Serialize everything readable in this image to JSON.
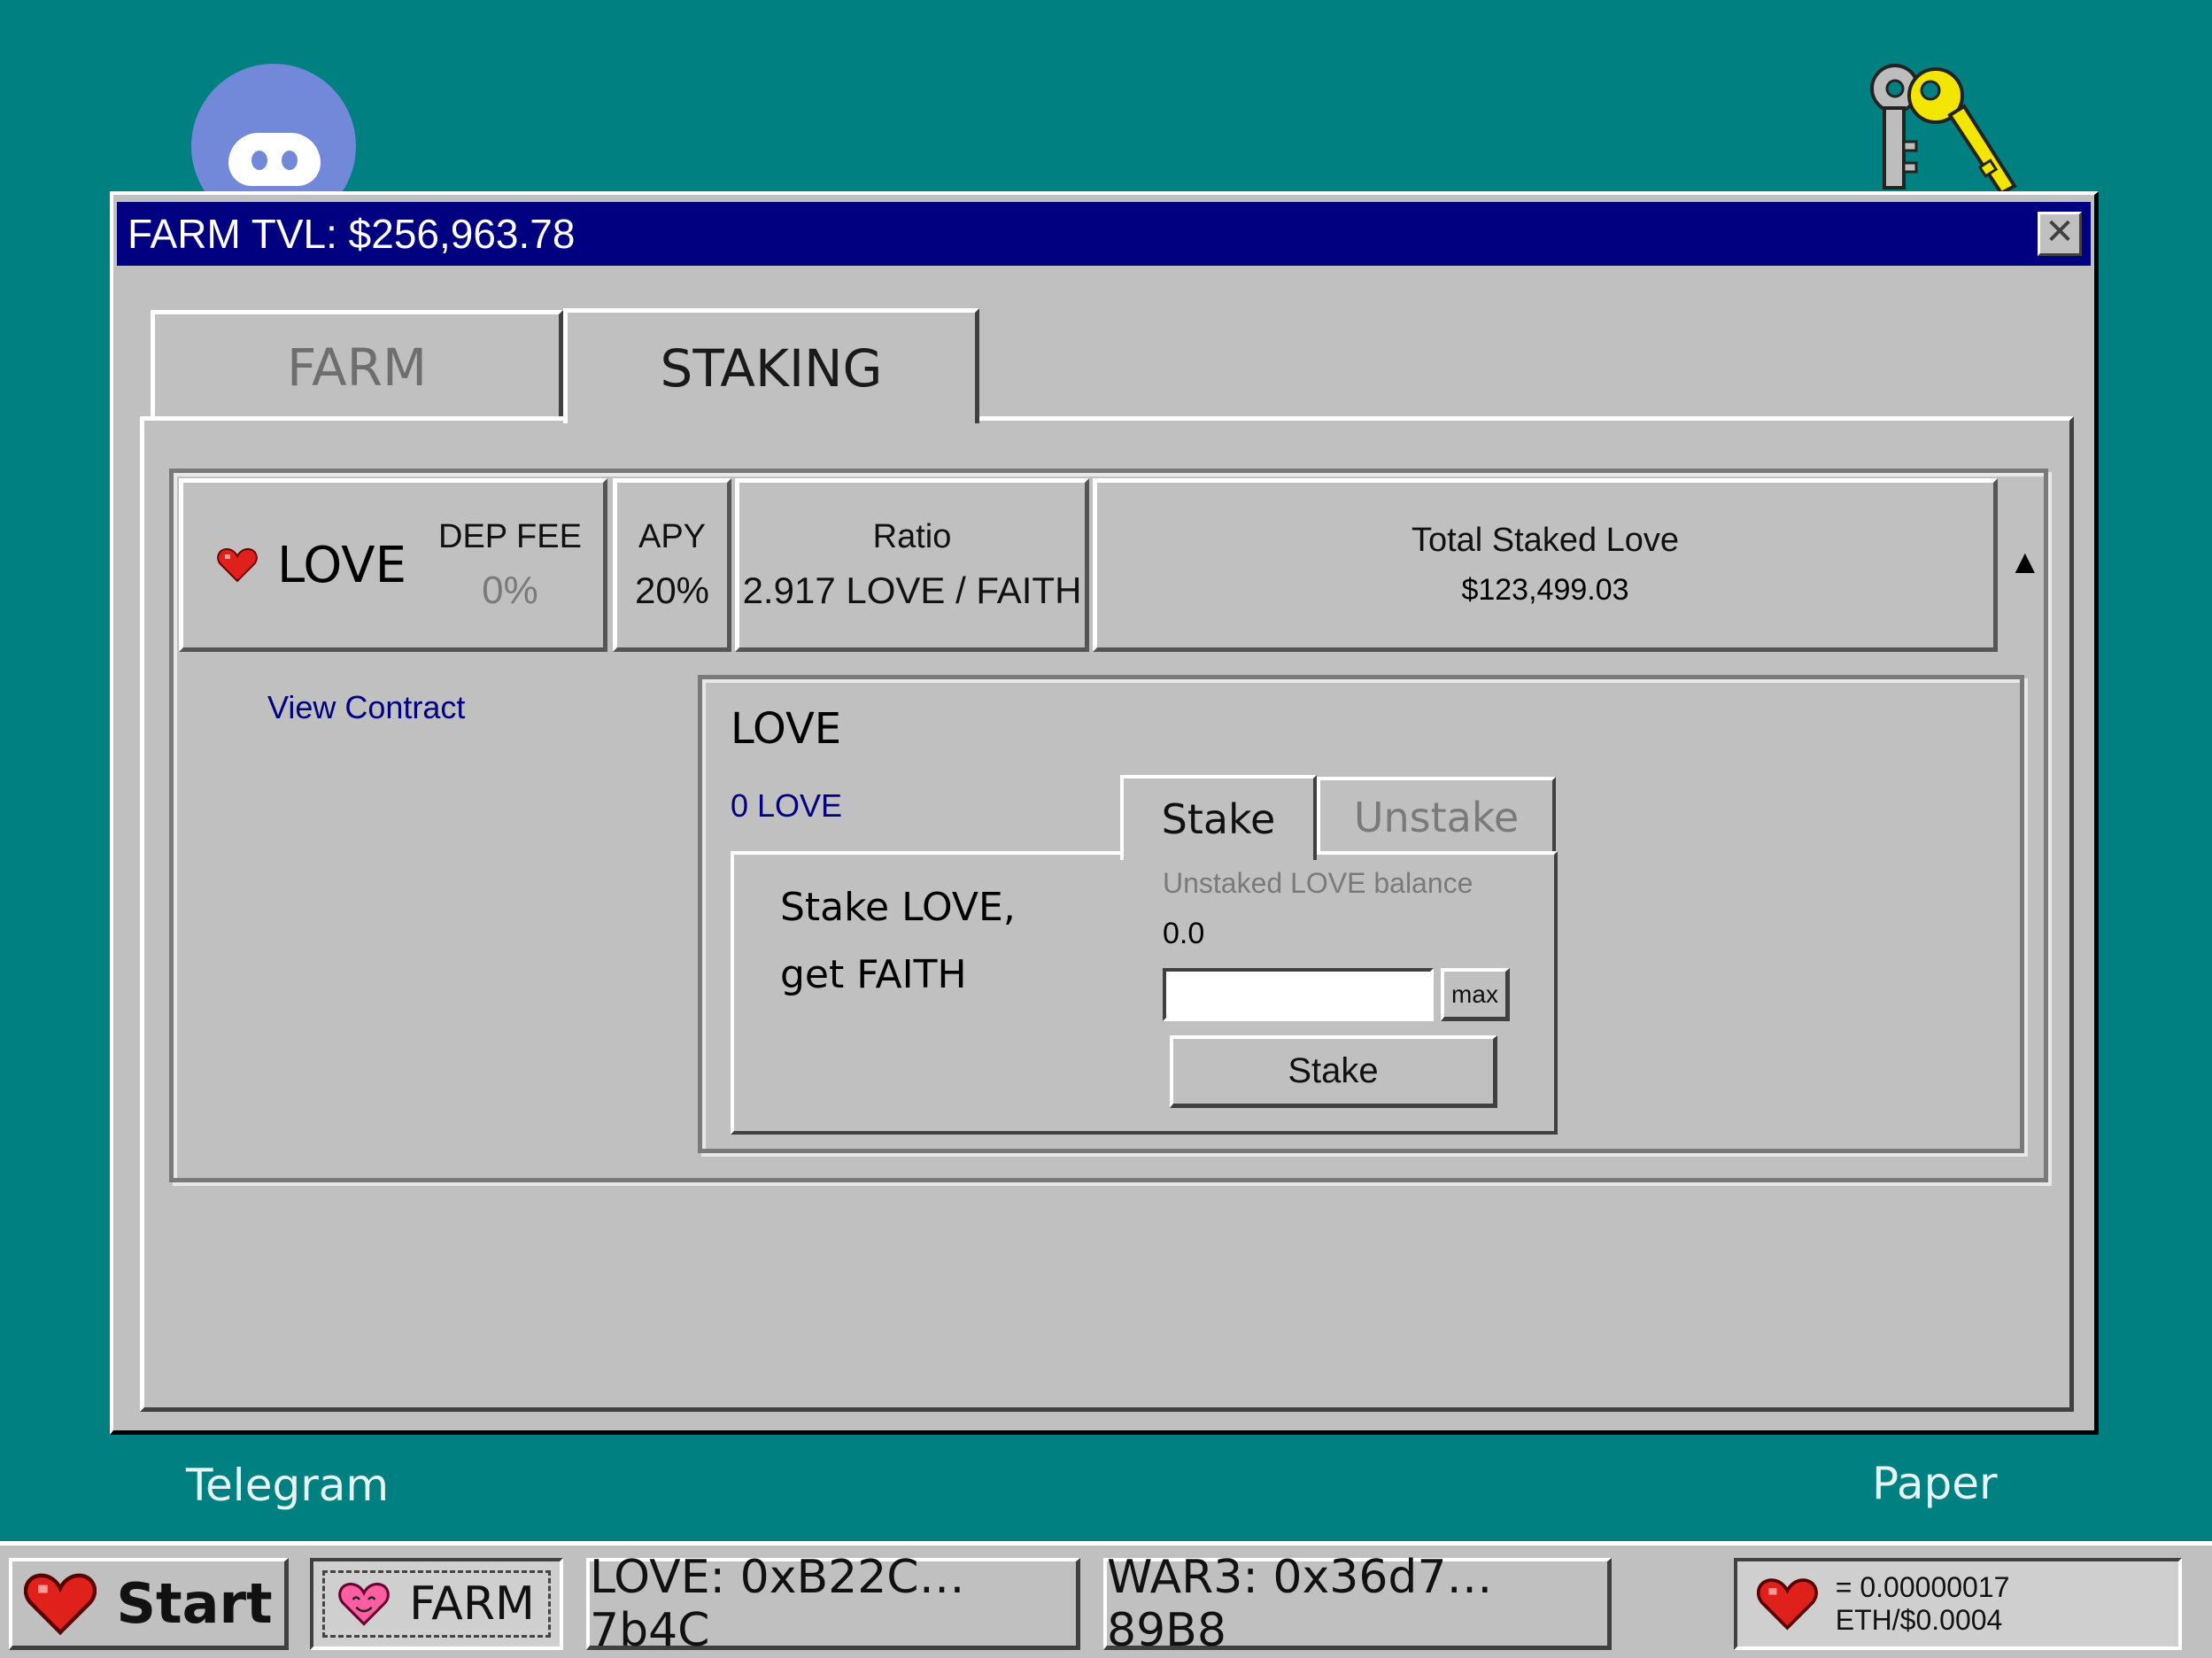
{
  "colors": {
    "desktop": "#008080",
    "titlebar": "#000080",
    "heart": "#e0201a",
    "link": "#000080",
    "window": "#c0c0c0"
  },
  "desktop": {
    "icons": [
      {
        "icon": "discord-icon"
      },
      {
        "icon": "key-icon"
      }
    ],
    "telegram_label": "Telegram",
    "paper_label": "Paper"
  },
  "window": {
    "title": "FARM TVL: $256,963.78",
    "close_glyph": "✕",
    "tabs": [
      {
        "label": "FARM",
        "active": false
      },
      {
        "label": "STAKING",
        "active": true
      }
    ],
    "pool": {
      "token": "LOVE",
      "dep_fee_label": "DEP FEE",
      "dep_fee_value": "0%",
      "apy_label": "APY",
      "apy_value": "20%",
      "ratio_label": "Ratio",
      "ratio_value": "2.917 LOVE / FAITH",
      "total_label": "Total Staked Love",
      "total_value": "$123,499.03",
      "collapse_glyph": "▲",
      "view_contract": "View Contract",
      "detail": {
        "token": "LOVE",
        "balance": "0 LOVE",
        "stake_tab": "Stake",
        "unstake_tab": "Unstake",
        "description_line1": "Stake LOVE,",
        "description_line2": "get FAITH",
        "balance_label": "Unstaked LOVE balance",
        "balance_value": "0.0",
        "amount_value": "",
        "max_label": "max",
        "stake_button": "Stake"
      }
    }
  },
  "taskbar": {
    "start_label": "Start",
    "farm_label": "FARM",
    "love_address": "LOVE: 0xB22C…7b4C",
    "war3_address": "WAR3: 0x36d7…89B8",
    "price": "= 0.00000017 ETH/$0.0004"
  }
}
